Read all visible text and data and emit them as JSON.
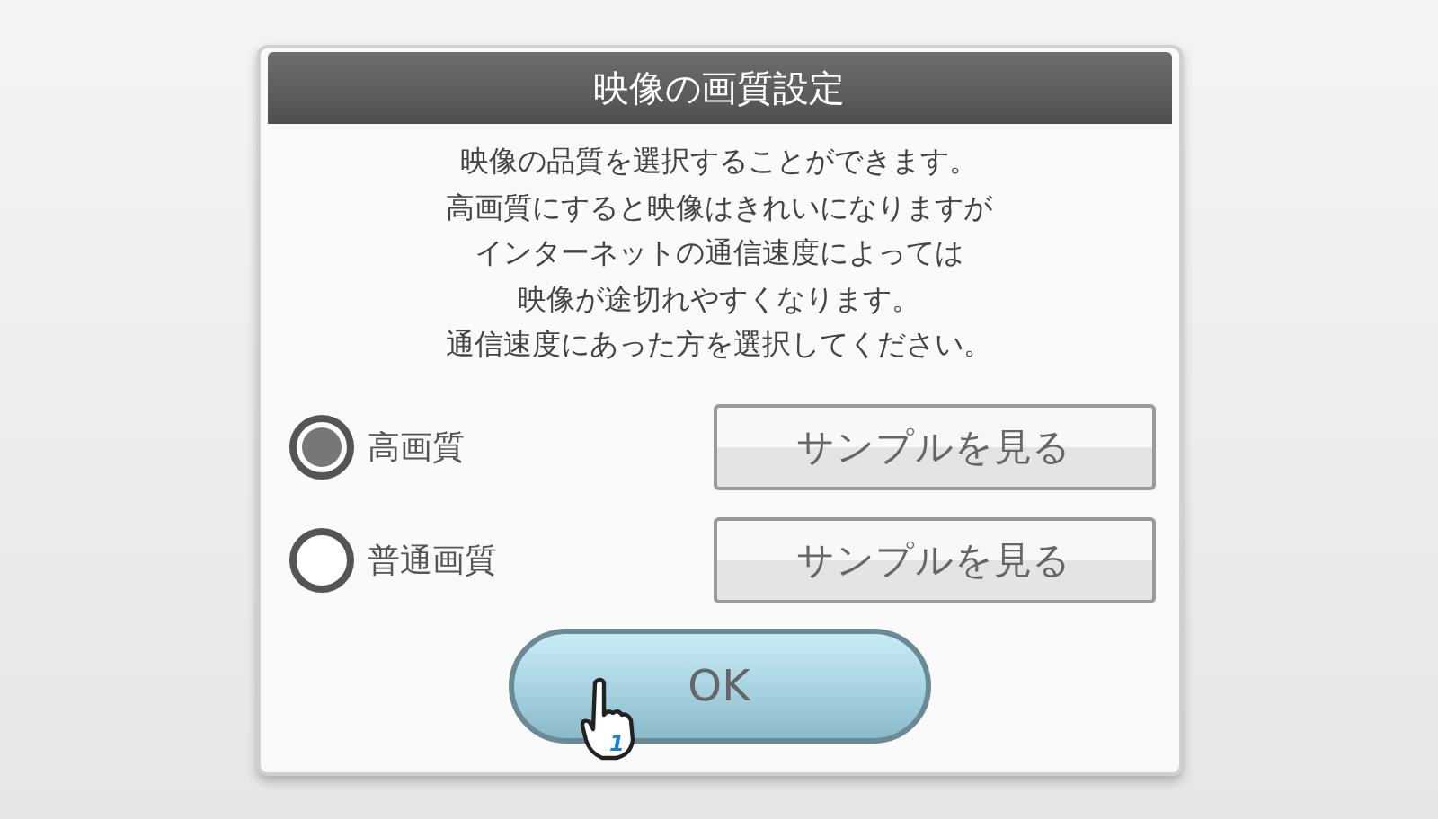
{
  "dialog": {
    "title": "映像の画質設定",
    "message_lines": [
      "映像の品質を選択することができます。",
      "高画質にすると映像はきれいになりますが",
      "インターネットの通信速度によっては",
      "映像が途切れやすくなります。",
      "通信速度にあった方を選択してください。"
    ],
    "options": [
      {
        "label": "高画質",
        "selected": true,
        "button": "サンプルを見る"
      },
      {
        "label": "普通画質",
        "selected": false,
        "button": "サンプルを見る"
      }
    ],
    "ok_button": "OK"
  },
  "cursor": {
    "player": "1"
  }
}
